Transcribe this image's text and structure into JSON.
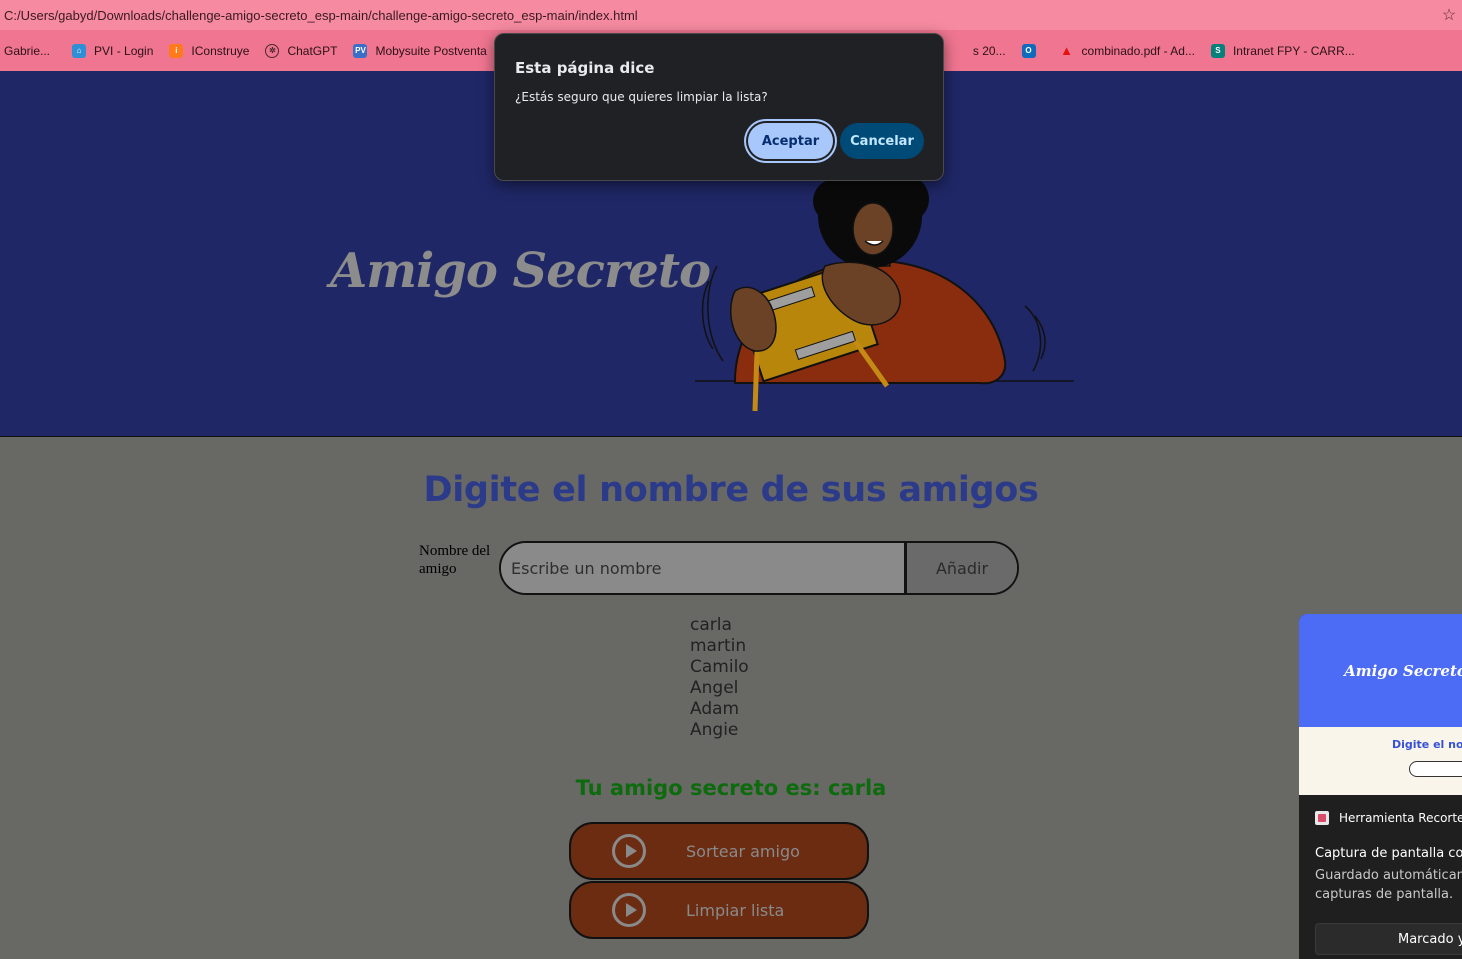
{
  "browser": {
    "url": "C:/Users/gabyd/Downloads/challenge-amigo-secreto_esp-main/challenge-amigo-secreto_esp-main/index.html",
    "star_icon": "star-icon",
    "bookmarks": [
      {
        "label": "Gabrie...",
        "icon": "bookmark-icon",
        "color": "#d04a6a"
      },
      {
        "label": "PVI - Login",
        "icon": "home-icon",
        "color": "#2f8fd6"
      },
      {
        "label": "IConstruye",
        "icon": "iconstruye-icon",
        "color": "#ff7a1a"
      },
      {
        "label": "ChatGPT",
        "icon": "chatgpt-icon",
        "color": "#e5e5e5"
      },
      {
        "label": "Mobysuite Postventa",
        "icon": "pv-icon",
        "color": "#3a6fc8"
      },
      {
        "label": "s 20...",
        "icon": "bookmark-icon",
        "color": "#6a4ad0"
      },
      {
        "label": "",
        "icon": "outlook-icon",
        "color": "#0f6cbd"
      },
      {
        "label": "combinado.pdf - Ad...",
        "icon": "adobe-icon",
        "color": "#e81010"
      },
      {
        "label": "Intranet FPY - CARR...",
        "icon": "sharepoint-icon",
        "color": "#06807a"
      }
    ]
  },
  "dialog": {
    "title": "Esta página dice",
    "message": "¿Estás seguro que quieres limpiar la lista?",
    "ok_label": "Aceptar",
    "cancel_label": "Cancelar"
  },
  "hero": {
    "title": "Amigo Secreto"
  },
  "main": {
    "title": "Digite el nombre de sus amigos",
    "input_label": "Nombre del amigo",
    "input_placeholder": "Escribe un nombre",
    "add_label": "Añadir",
    "friends": [
      "carla",
      "martin",
      "Camilo",
      "Angel",
      "Adam",
      "Angie"
    ],
    "result": "Tu amigo secreto es: carla",
    "draw_label": "Sortear amigo",
    "clear_label": "Limpiar lista"
  },
  "toast": {
    "preview_title": "Amigo Secreto",
    "preview_subtitle": "Digite el nom",
    "app_name": "Herramienta Recortes",
    "line1": "Captura de pantalla cop",
    "line2": "Guardado automáticam capturas de pantalla.",
    "button": "Marcado y"
  },
  "colors": {
    "hero_bg": "#1f2766",
    "page_bg": "#686865",
    "accent_title": "#2c3a8a",
    "result_green": "#0d6b0d",
    "button_bg": "#6b2c12"
  }
}
